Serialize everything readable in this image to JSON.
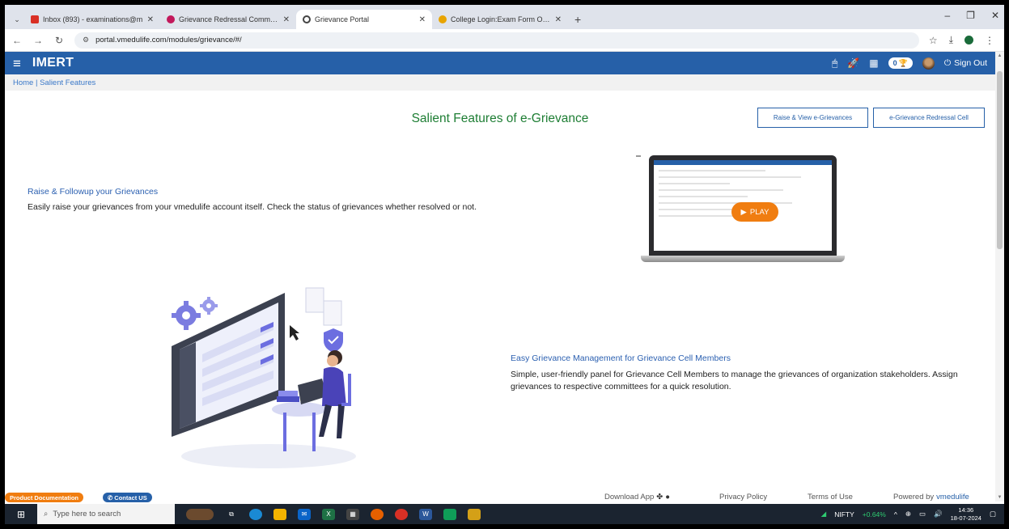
{
  "browser": {
    "tabs": [
      {
        "label": "Inbox (893) - examinations@m",
        "icon_color": "#d93025",
        "active": false
      },
      {
        "label": "Grievance Redressal Committe",
        "icon_color": "#c2185b",
        "active": false
      },
      {
        "label": "Grievance Portal",
        "icon_color": "#444444",
        "active": true
      },
      {
        "label": "College Login:Exam Form Onlin",
        "icon_color": "#e8a400",
        "active": false
      }
    ],
    "url": "portal.vmedulife.com/modules/grievance/#/"
  },
  "header": {
    "brand": "IMERT",
    "trophy_count": "0",
    "signout_label": "Sign Out",
    "bg_color": "#2660a8"
  },
  "breadcrumb": "Home | Salient Features",
  "page": {
    "title": "Salient Features of e-Grievance",
    "btn_raise": "Raise & View e-Grievances",
    "btn_cell": "e-Grievance Redressal Cell",
    "feature1_title": "Raise & Followup your Grievances",
    "feature1_text": "Easily raise your grievances from your vmedulife account itself. Check the status of grievances whether resolved or not.",
    "play_label": "PLAY",
    "feature2_title": "Easy Grievance Management for Grievance Cell Members",
    "feature2_text": "Simple, user-friendly panel for Grievance Cell Members to manage the grievances of organization stakeholders. Assign grievances to respective committees for a quick resolution."
  },
  "footer": {
    "product_docs": "Product Documentation",
    "contact": "Contact US",
    "download": "Download App",
    "privacy": "Privacy Policy",
    "terms": "Terms of Use",
    "powered_prefix": "Powered by ",
    "powered_brand": "vmedulife"
  },
  "taskbar": {
    "search_placeholder": "Type here to search",
    "nifty_label": "NIFTY",
    "nifty_change": "+0.64%",
    "time": "14:36",
    "date": "18-07-2024"
  }
}
